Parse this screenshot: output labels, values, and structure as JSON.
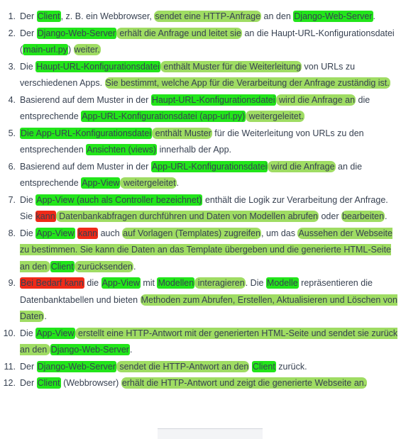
{
  "items": [
    {
      "num": "1.",
      "segments": [
        {
          "t": "Der "
        },
        {
          "t": "Client",
          "h": "b"
        },
        {
          "t": ", z. B. ein Webbrowser, "
        },
        {
          "t": "sendet eine HTTP-Anfrage",
          "h": "l"
        },
        {
          "t": " an den "
        },
        {
          "t": "Django-Web-Server",
          "h": "b"
        },
        {
          "t": "."
        }
      ]
    },
    {
      "num": "2.",
      "segments": [
        {
          "t": "Der "
        },
        {
          "t": "Django-Web-Server",
          "h": "b"
        },
        {
          "t": " erhält die Anfrage und leitet sie",
          "h": "l"
        },
        {
          "t": " an die Haupt-URL-Konfigurationsdatei ("
        },
        {
          "t": "main-url.py",
          "h": "b"
        },
        {
          "t": ") "
        },
        {
          "t": "weiter.",
          "h": "l"
        }
      ]
    },
    {
      "num": "3.",
      "segments": [
        {
          "t": "Die "
        },
        {
          "t": "Haupt-URL-Konfigurationsdatei",
          "h": "b"
        },
        {
          "t": " enthält Muster für die Weiterleitung",
          "h": "l"
        },
        {
          "t": " von URLs zu verschiedenen Apps. "
        },
        {
          "t": "Sie bestimmt, welche App für die Verarbeitung der Anfrage zuständig ist.",
          "h": "l"
        }
      ]
    },
    {
      "num": "4.",
      "segments": [
        {
          "t": "Basierend auf dem Muster in der "
        },
        {
          "t": "Haupt-URL-Konfigurationsdatei",
          "h": "b"
        },
        {
          "t": " wird die Anfrage an",
          "h": "l"
        },
        {
          "t": " die entsprechende "
        },
        {
          "t": "App-URL-Konfigurationsdatei (app-url.py)",
          "h": "b"
        },
        {
          "t": " weitergeleitet.",
          "h": "l"
        }
      ]
    },
    {
      "num": "5.",
      "segments": [
        {
          "t": "Die App-URL-Konfigurationsdatei",
          "h": "b"
        },
        {
          "t": " enthält Muster",
          "h": "l"
        },
        {
          "t": " für die Weiterleitung von URLs zu den entsprechenden "
        },
        {
          "t": "Ansichten (views)",
          "h": "b"
        },
        {
          "t": " innerhalb der App."
        }
      ]
    },
    {
      "num": "6.",
      "segments": [
        {
          "t": "Basierend auf dem Muster in der "
        },
        {
          "t": "App-URL-Konfigurationsdatei",
          "h": "b"
        },
        {
          "t": " wird die Anfrage",
          "h": "l"
        },
        {
          "t": " an die entsprechende "
        },
        {
          "t": "App-View",
          "h": "b"
        },
        {
          "t": " weitergeleitet",
          "h": "l"
        },
        {
          "t": "."
        }
      ]
    },
    {
      "num": "7.",
      "segments": [
        {
          "t": "Die "
        },
        {
          "t": "App-View (auch als Controller bezeichnet)",
          "h": "b"
        },
        {
          "t": " enthält die Logik zur Verarbeitung der Anfrage. Sie "
        },
        {
          "t": "kann",
          "h": "r"
        },
        {
          "t": " Datenbankabfragen durchführen und Daten von Modellen abrufen",
          "h": "l"
        },
        {
          "t": " oder "
        },
        {
          "t": "bearbeiten",
          "h": "l"
        },
        {
          "t": "."
        }
      ]
    },
    {
      "num": "8.",
      "segments": [
        {
          "t": "Die "
        },
        {
          "t": "App-View",
          "h": "b"
        },
        {
          "t": " "
        },
        {
          "t": "kann",
          "h": "r"
        },
        {
          "t": " auch "
        },
        {
          "t": "auf Vorlagen (Templates) zugreifen",
          "h": "l"
        },
        {
          "t": ", um das "
        },
        {
          "t": "Aussehen der Webseite zu bestimmen. Sie kann die Daten an das Template übergeben und die generierte HTML-Seite an den ",
          "h": "l"
        },
        {
          "t": "Client",
          "h": "b"
        },
        {
          "t": " zurücksenden",
          "h": "l"
        },
        {
          "t": "."
        }
      ]
    },
    {
      "num": "9.",
      "segments": [
        {
          "t": "Bei Bedarf kann",
          "h": "r"
        },
        {
          "t": " die "
        },
        {
          "t": "App-View",
          "h": "b"
        },
        {
          "t": " mit "
        },
        {
          "t": "Modellen",
          "h": "b"
        },
        {
          "t": " interagieren",
          "h": "l"
        },
        {
          "t": ". Die "
        },
        {
          "t": "Modelle",
          "h": "b"
        },
        {
          "t": " repräsentieren die Datenbanktabellen und bieten "
        },
        {
          "t": "Methoden zum Abrufen, Erstellen, Aktualisieren und Löschen von Daten",
          "h": "l"
        },
        {
          "t": "."
        }
      ]
    },
    {
      "num": "10.",
      "segments": [
        {
          "t": "Die "
        },
        {
          "t": "App-View",
          "h": "b"
        },
        {
          "t": " erstellt eine HTTP-Antwort mit der generierten HTML-Seite und sendet sie zurück an den ",
          "h": "l"
        },
        {
          "t": "Django-Web-Server",
          "h": "b"
        },
        {
          "t": "."
        }
      ]
    },
    {
      "num": "11.",
      "segments": [
        {
          "t": "Der "
        },
        {
          "t": "Django-Web-Server",
          "h": "b"
        },
        {
          "t": " sendet die HTTP-Antwort an den",
          "h": "l"
        },
        {
          "t": " "
        },
        {
          "t": "Client",
          "h": "b"
        },
        {
          "t": " zurück."
        }
      ]
    },
    {
      "num": "12.",
      "segments": [
        {
          "t": "Der "
        },
        {
          "t": "Client",
          "h": "b"
        },
        {
          "t": " (Webbrowser) "
        },
        {
          "t": "erhält die HTTP-Antwort und zeigt die generierte Webseite an.",
          "h": "l"
        }
      ]
    }
  ]
}
